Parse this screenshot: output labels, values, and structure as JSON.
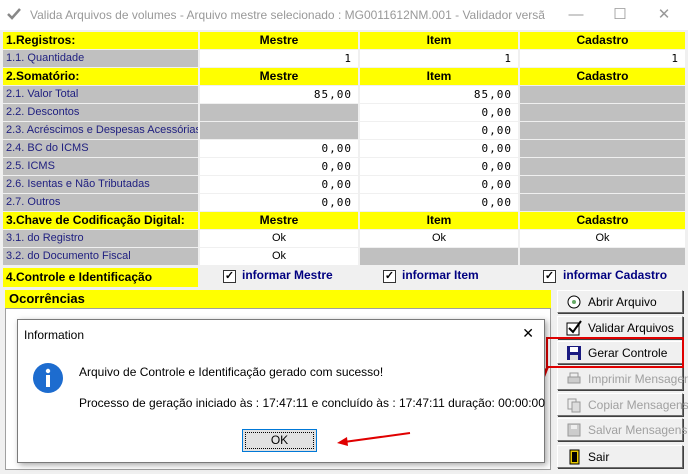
{
  "window": {
    "title": "Valida Arquivos de volumes - Arquivo mestre selecionado : MG0011612NM.001  - Validador versã"
  },
  "sections": {
    "registros": {
      "label": "1.Registros:",
      "headers": [
        "Mestre",
        "Item",
        "Cadastro"
      ],
      "rows": [
        {
          "label": "1.1. Quantidade",
          "mestre": "1",
          "item": "1",
          "cadastro": "1"
        }
      ]
    },
    "somatorio": {
      "label": "2.Somatório:",
      "headers": [
        "Mestre",
        "Item",
        "Cadastro"
      ],
      "rows": [
        {
          "label": "2.1. Valor Total",
          "mestre": "85,00",
          "item": "85,00",
          "cadastro": ""
        },
        {
          "label": "2.2. Descontos",
          "mestre": "",
          "item": "0,00",
          "cadastro": ""
        },
        {
          "label": "2.3. Acréscimos e Despesas Acessórias",
          "mestre": "",
          "item": "0,00",
          "cadastro": ""
        },
        {
          "label": "2.4. BC do ICMS",
          "mestre": "0,00",
          "item": "0,00",
          "cadastro": ""
        },
        {
          "label": "2.5. ICMS",
          "mestre": "0,00",
          "item": "0,00",
          "cadastro": ""
        },
        {
          "label": "2.6. Isentas e Não Tributadas",
          "mestre": "0,00",
          "item": "0,00",
          "cadastro": ""
        },
        {
          "label": "2.7. Outros",
          "mestre": "0,00",
          "item": "0,00",
          "cadastro": ""
        }
      ]
    },
    "chave": {
      "label": "3.Chave de Codificação Digital:",
      "headers": [
        "Mestre",
        "Item",
        "Cadastro"
      ],
      "rows": [
        {
          "label": "3.1. do Registro",
          "mestre": "Ok",
          "item": "Ok",
          "cadastro": "Ok"
        },
        {
          "label": "3.2. do Documento Fiscal",
          "mestre": "Ok",
          "item": "",
          "cadastro": ""
        }
      ]
    },
    "controle": {
      "label": "4.Controle e Identificação",
      "checks": [
        {
          "label": "informar Mestre",
          "checked": true
        },
        {
          "label": "informar Item",
          "checked": true
        },
        {
          "label": "informar Cadastro",
          "checked": true
        }
      ]
    }
  },
  "ocorrencias": {
    "label": "Ocorrências"
  },
  "buttons": {
    "abrir": "Abrir Arquivo",
    "validar": "Validar Arquivos",
    "gerar": "Gerar Controle",
    "imprimir": "Imprimir Mensagens",
    "copiar": "Copiar Mensagens",
    "salvar": "Salvar Mensagens",
    "sair": "Sair"
  },
  "dialog": {
    "title": "Information",
    "message": "Arquivo de Controle e Identificação gerado com sucesso!",
    "detail": "Processo de geração iniciado às : 17:47:11 e concluído às : 17:47:11 duração: 00:00:00",
    "ok_label": "OK"
  },
  "colors": {
    "header_yellow": "#ffff00",
    "label_gray": "#c0c0c0",
    "annotation_red": "#e00000"
  }
}
